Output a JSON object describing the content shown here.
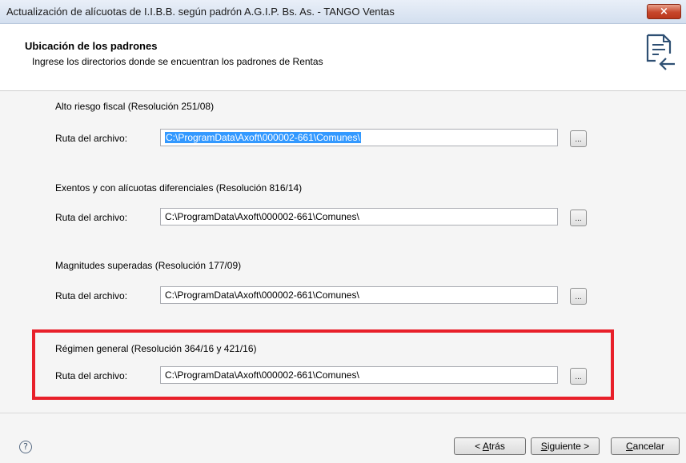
{
  "window": {
    "title": "Actualización de alícuotas de I.I.B.B. según padrón A.G.I.P. Bs. As. - TANGO Ventas",
    "close_glyph": "×"
  },
  "header": {
    "title": "Ubicación de los padrones",
    "subtitle": "Ingrese los directorios donde se encuentran los padrones de Rentas",
    "icon": "document-import-icon"
  },
  "groups": [
    {
      "label": "Alto riesgo fiscal (Resolución 251/08)",
      "field_label": "Ruta del archivo:",
      "path": "C:\\ProgramData\\Axoft\\000002-661\\Comunes\\",
      "selected": true,
      "browse_label": "..."
    },
    {
      "label": "Exentos y con alícuotas diferenciales (Resolución 816/14)",
      "field_label": "Ruta del archivo:",
      "path": "C:\\ProgramData\\Axoft\\000002-661\\Comunes\\",
      "selected": false,
      "browse_label": "..."
    },
    {
      "label": "Magnitudes superadas (Resolución 177/09)",
      "field_label": "Ruta del archivo:",
      "path": "C:\\ProgramData\\Axoft\\000002-661\\Comunes\\",
      "selected": false,
      "browse_label": "..."
    },
    {
      "label": "Régimen general (Resolución 364/16 y 421/16)",
      "field_label": "Ruta del archivo:",
      "path": "C:\\ProgramData\\Axoft\\000002-661\\Comunes\\",
      "selected": false,
      "browse_label": "..."
    }
  ],
  "footer": {
    "help_glyph": "?",
    "back": {
      "prefix": "< ",
      "mnemonic": "A",
      "rest": "trás"
    },
    "next": {
      "mnemonic": "S",
      "rest": "iguiente >"
    },
    "cancel": {
      "mnemonic": "C",
      "rest": "ancelar"
    }
  },
  "colors": {
    "highlight": "#e8202a",
    "selection": "#3399ff",
    "close_button": "#c7462b"
  }
}
